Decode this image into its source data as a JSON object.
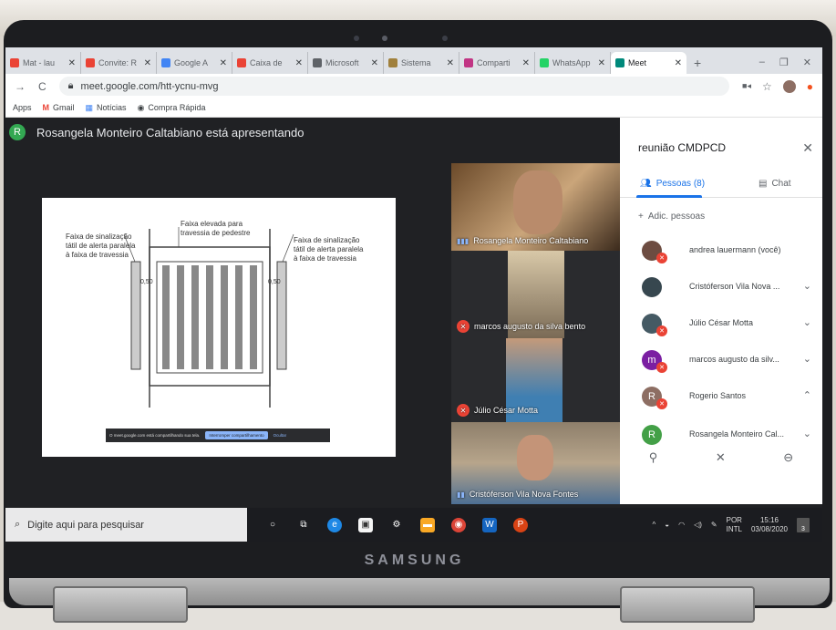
{
  "browser": {
    "tabs": [
      {
        "label": "Mat - lau",
        "icon": "gmail-icon",
        "color": "#ea4335"
      },
      {
        "label": "Convite: R",
        "icon": "gmail-icon",
        "color": "#ea4335"
      },
      {
        "label": "Google A",
        "icon": "docs-icon",
        "color": "#4285f4"
      },
      {
        "label": "Caixa de",
        "icon": "gmail-icon",
        "color": "#ea4335"
      },
      {
        "label": "Microsoft",
        "icon": "globe-icon",
        "color": "#5f6368"
      },
      {
        "label": "Sistema",
        "icon": "crest-icon",
        "color": "#a0803c"
      },
      {
        "label": "Comparti",
        "icon": "instagram-icon",
        "color": "#c13584"
      },
      {
        "label": "WhatsApp",
        "icon": "whatsapp-icon",
        "color": "#25d366"
      },
      {
        "label": "Meet",
        "icon": "meet-icon",
        "color": "#00897b",
        "active": true
      }
    ],
    "new_tab": "+",
    "url": "meet.google.com/htt-ycnu-mvg",
    "bookmarks": [
      {
        "label": "Apps"
      },
      {
        "label": "Gmail"
      },
      {
        "label": "Notícias"
      },
      {
        "label": "Compra Rápida"
      }
    ]
  },
  "meet": {
    "presenter_initial": "R",
    "presenter_text": "Rosangela Monteiro Caltabiano está apresentando",
    "slide": {
      "label_left": [
        "Faixa de sinalização",
        "tátil de alerta paralela",
        "à faixa de travessia"
      ],
      "label_center": [
        "Faixa elevada para",
        "travessia de pedestre"
      ],
      "label_right": [
        "Faixa de sinalização",
        "tátil de alerta paralela",
        "à faixa de travessia"
      ],
      "dim_left": "0,50",
      "dim_right": "0,50",
      "share_text": "O meet.google.com está compartilhando sua tela.",
      "share_stop": "Interromper compartilhamento",
      "share_hide": "Ocultar"
    },
    "tiles": [
      {
        "name": "Rosangela Monteiro Caltabiano",
        "muted": false
      },
      {
        "name": "marcos augusto da silva bento",
        "muted": true
      },
      {
        "name": "Júlio César Motta",
        "muted": true
      },
      {
        "name": "Cristóferson Vila Nova Fontes",
        "muted": false
      }
    ]
  },
  "panel": {
    "title": "reunião CMDPCD",
    "tab_people": "Pessoas (8)",
    "tab_chat": "Chat",
    "add_people": "Adic. pessoas",
    "participants": [
      {
        "name": "andrea lauermann (você)",
        "initial": "",
        "color": "#6d4c41",
        "muted": true
      },
      {
        "name": "Cristóferson Vila Nova ...",
        "initial": "",
        "color": "#37474f",
        "muted": false
      },
      {
        "name": "Júlio César Motta",
        "initial": "",
        "color": "#455a64",
        "muted": true
      },
      {
        "name": "marcos augusto da silv...",
        "initial": "m",
        "color": "#7b1fa2",
        "muted": true
      },
      {
        "name": "Rogerio Santos",
        "initial": "R",
        "color": "#8d6e63",
        "muted": true
      },
      {
        "name": "Rosangela Monteiro Cal...",
        "initial": "R",
        "color": "#43a047",
        "muted": false
      }
    ]
  },
  "taskbar": {
    "search_placeholder": "Digite aqui para pesquisar",
    "lang_top": "POR",
    "lang_bottom": "INTL",
    "time": "15:16",
    "date": "03/08/2020",
    "notifications": "3"
  },
  "device": {
    "brand": "SAMSUNG"
  }
}
